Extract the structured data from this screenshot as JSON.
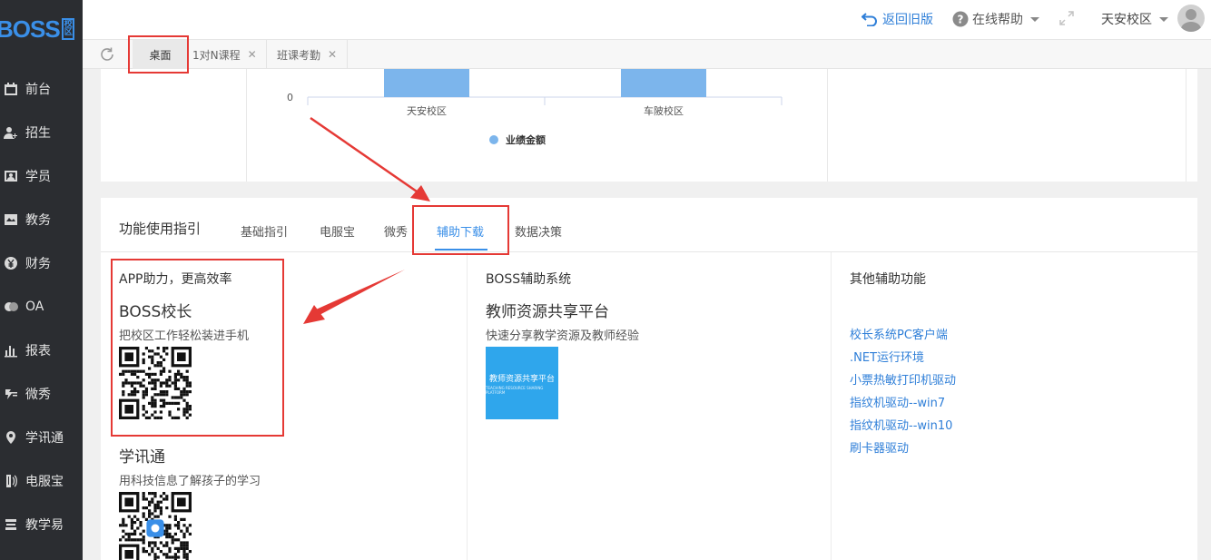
{
  "brand": {
    "logo_text": "BOSS",
    "logo_badge": "校区"
  },
  "sidebar": {
    "items": [
      {
        "label": "前台",
        "icon": "calendar-icon"
      },
      {
        "label": "招生",
        "icon": "user-add-icon"
      },
      {
        "label": "学员",
        "icon": "id-card-icon"
      },
      {
        "label": "教务",
        "icon": "book-icon"
      },
      {
        "label": "财务",
        "icon": "yen-icon"
      },
      {
        "label": "OA",
        "icon": "chat-icon"
      },
      {
        "label": "报表",
        "icon": "bar-chart-icon"
      },
      {
        "label": "微秀",
        "icon": "weixiu-icon"
      },
      {
        "label": "学讯通",
        "icon": "location-icon"
      },
      {
        "label": "电服宝",
        "icon": "phone-icon"
      },
      {
        "label": "教学易",
        "icon": "teaching-icon"
      }
    ]
  },
  "header": {
    "back_old": "返回旧版",
    "online_help": "在线帮助",
    "campus": "天安校区"
  },
  "tabs": [
    {
      "label": "桌面"
    },
    {
      "label": "1对N课程"
    },
    {
      "label": "班课考勤"
    }
  ],
  "chart_data": {
    "type": "bar",
    "categories": [
      "天安校区",
      "车陂校区"
    ],
    "series": [
      {
        "name": "业绩金额",
        "values": [
          null,
          null
        ]
      }
    ],
    "y_tick_visible": "0"
  },
  "guide": {
    "title": "功能使用指引",
    "tabs": [
      "基础指引",
      "电服宝",
      "微秀",
      "辅助下载",
      "数据决策"
    ],
    "active_tab": "辅助下载",
    "col1": {
      "heading": "APP助力，更高效率",
      "apps": [
        {
          "name": "BOSS校长",
          "desc": "把校区工作轻松装进手机"
        },
        {
          "name": "学讯通",
          "desc": "用科技信息了解孩子的学习"
        }
      ]
    },
    "col2": {
      "heading": "BOSS辅助系统",
      "app_name": "教师资源共享平台",
      "app_desc": "快速分享教学资源及教师经验",
      "image_title": "教师资源共享平台",
      "image_subtitle": "TEACHING RESOURCE SHARING PLATFORM"
    },
    "col3": {
      "heading": "其他辅助功能",
      "links": [
        "校长系统PC客户端",
        ".NET运行环境",
        "小票热敏打印机驱动",
        "指纹机驱动--win7",
        "指纹机驱动--win10",
        "刷卡器驱动"
      ]
    }
  },
  "colors": {
    "accent": "#3a8fe8",
    "bar": "#7cb5ec",
    "annotation": "#e53935",
    "sidebar_bg": "#2b2d31"
  }
}
